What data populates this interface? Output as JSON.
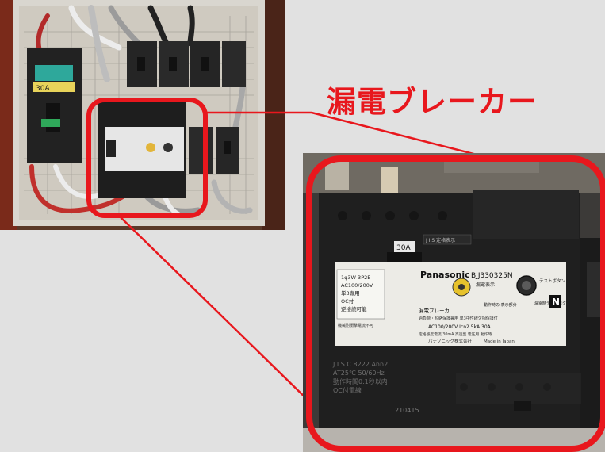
{
  "headline": "漏電ブレーカー",
  "colors": {
    "accent_red": "#e8171d",
    "background": "#e1e1e1"
  },
  "left_photo": {
    "main_breaker": {
      "rating": "30A"
    }
  },
  "zoom_photo": {
    "rating": "30A",
    "brand": "Panasonic",
    "model": "BJJ330325N",
    "standard_strip": "J I S 定格表示",
    "left_label": [
      "1φ3W 3P2E",
      "AC100/200V",
      "単3専用",
      "OC付",
      "逆接続可能"
    ],
    "left_label_small": "機械耐衝撃電流不可",
    "leak_indicator": "漏電表示",
    "test_button": "テストボタン",
    "test_label": "漏電時テストボタン",
    "trip_label": "動作時の 表示部分",
    "product_name": "漏電ブレーカ",
    "product_sub": "過負荷・短絡保護兼用 単3中性線欠相保護付",
    "spec_line": "AC100/200V Icn2.5kA 30A",
    "spec_line2": "定格感度電流 30mA 高速型 電圧用 動作時",
    "manufacturer": "パナソニック株式会社",
    "made_in": "Made in Japan",
    "neutral": "N",
    "bottom_lines": [
      "J I S  C  8222  Ann2",
      "AT25℃  50/60Hz",
      "動作時間0.1秒以内",
      "OC付電線"
    ],
    "serial": "210415"
  }
}
